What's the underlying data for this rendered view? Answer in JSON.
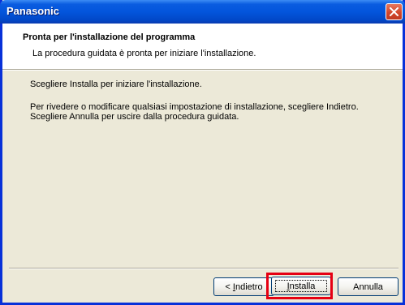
{
  "window": {
    "title": "Panasonic"
  },
  "header": {
    "title": "Pronta per l'installazione del programma",
    "subtitle": "La procedura guidata è pronta per iniziare l'installazione."
  },
  "body": {
    "line1": "Scegliere Installa per iniziare l'installazione.",
    "line2": "Per rivedere o modificare qualsiasi impostazione di installazione, scegliere Indietro. Scegliere Annulla per uscire dalla procedura guidata."
  },
  "buttons": {
    "back_prefix": "< ",
    "back_mnemonic": "I",
    "back_rest": "ndietro",
    "install_mnemonic": "I",
    "install_rest": "nstalla",
    "cancel": "Annulla"
  },
  "colors": {
    "highlight": "#e60012",
    "titlebar": "#0355dc"
  },
  "icons": {
    "close": "close-icon"
  }
}
